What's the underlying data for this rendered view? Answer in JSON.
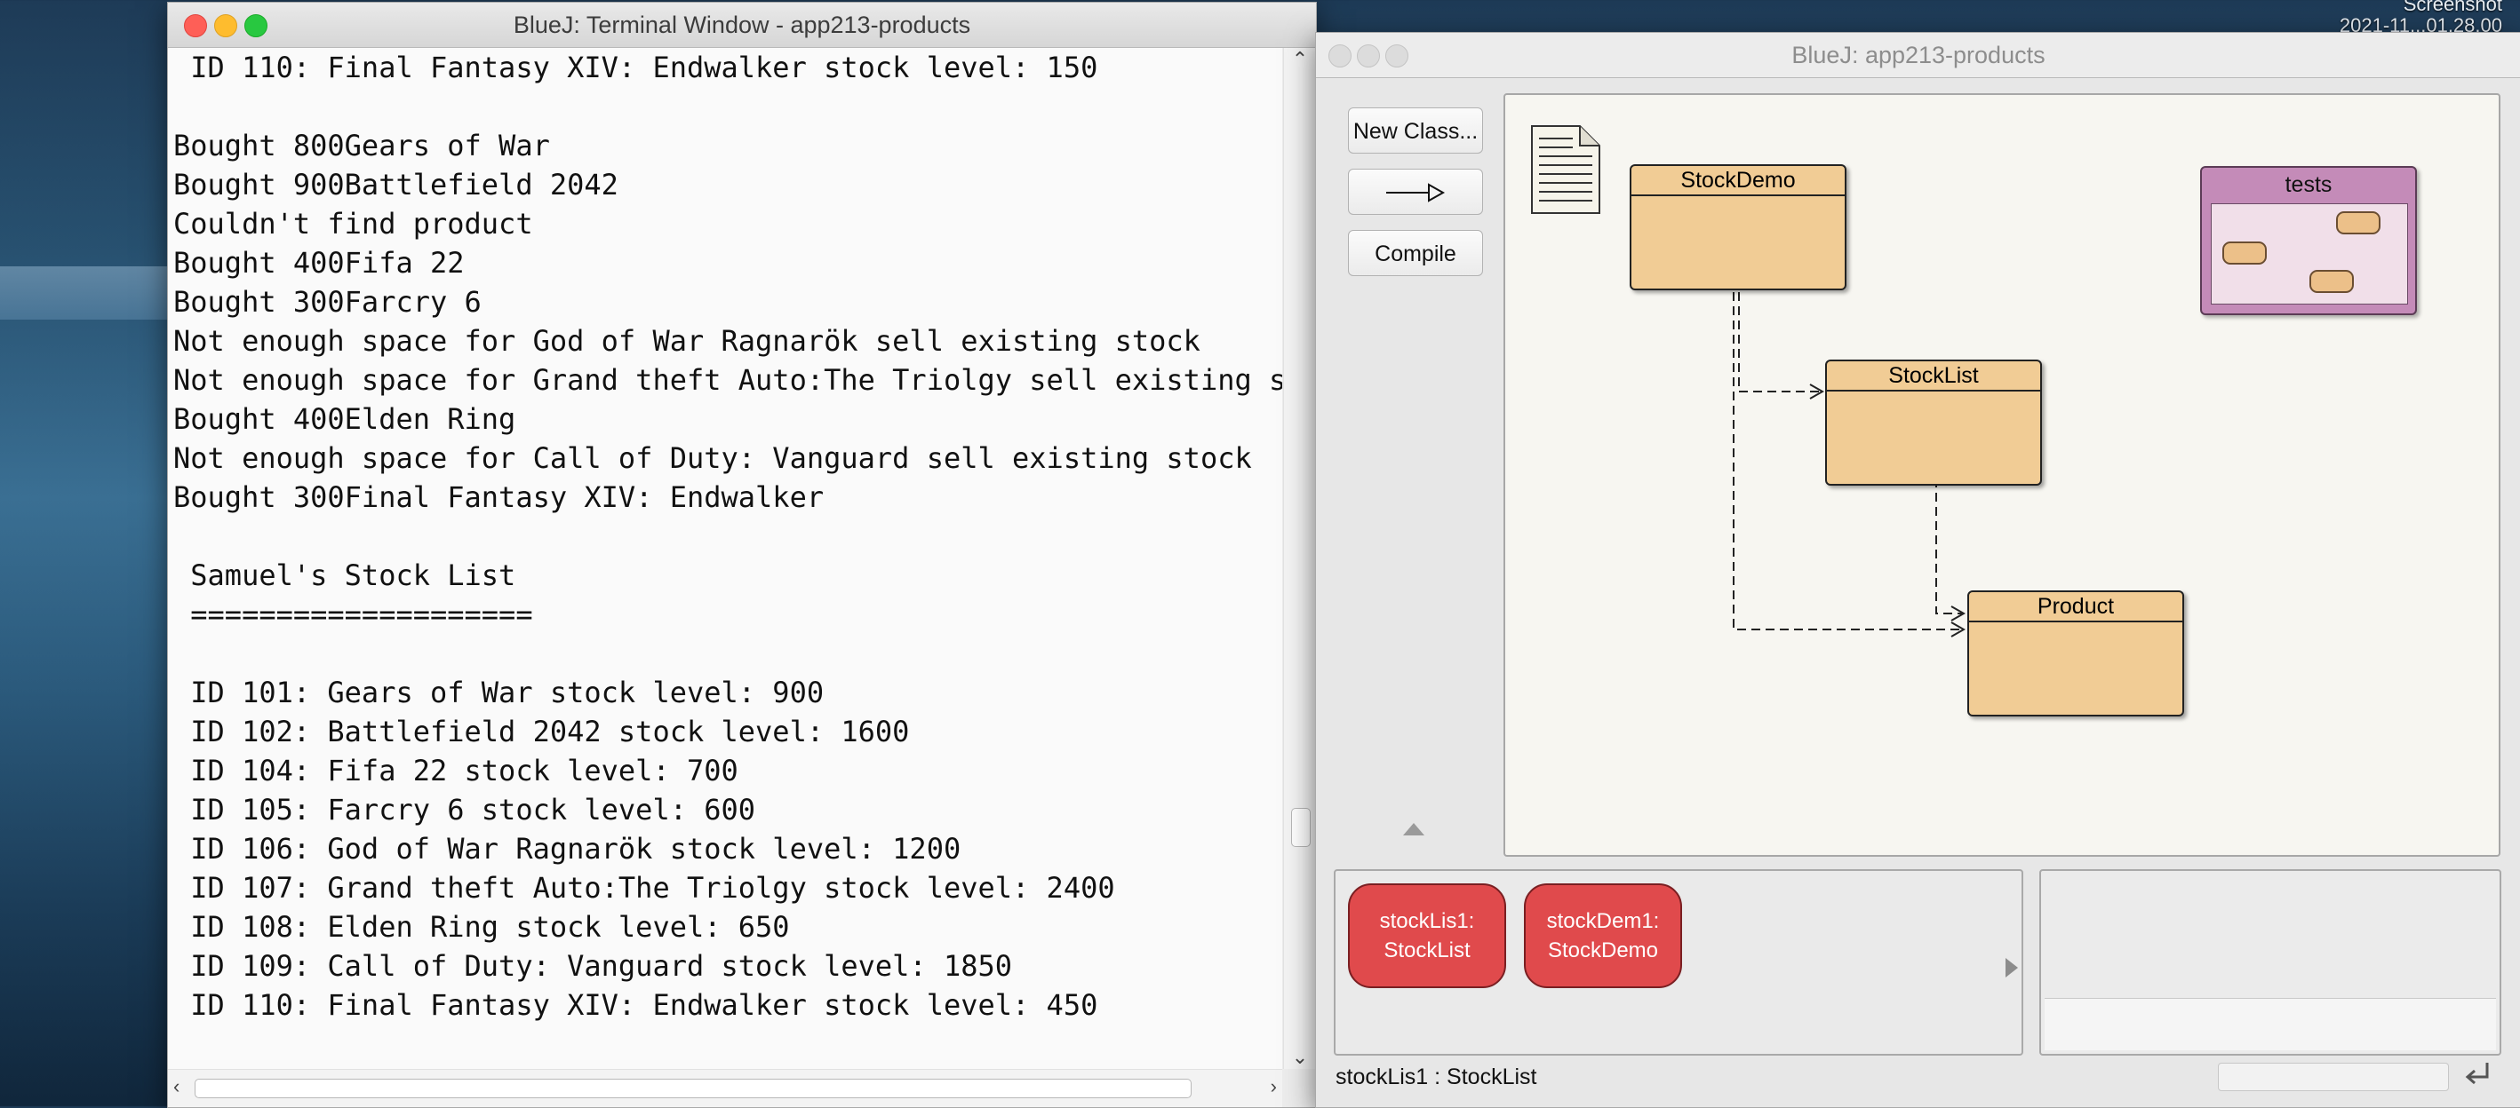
{
  "desktop": {
    "label_line1": "Screenshot",
    "label_line2": "2021-11...01.28.00"
  },
  "terminal": {
    "title": "BlueJ: Terminal Window - app213-products",
    "lines": [
      " ID 110: Final Fantasy XIV: Endwalker stock level: 150",
      "",
      "Bought 800Gears of War",
      "Bought 900Battlefield 2042",
      "Couldn't find product",
      "Bought 400Fifa 22",
      "Bought 300Farcry 6",
      "Not enough space for God of War Ragnarök sell existing stock",
      "Not enough space for Grand theft Auto:The Triolgy sell existing stock",
      "Bought 400Elden Ring",
      "Not enough space for Call of Duty: Vanguard sell existing stock",
      "Bought 300Final Fantasy XIV: Endwalker",
      "",
      " Samuel's Stock List",
      " ====================",
      "",
      " ID 101: Gears of War stock level: 900",
      " ID 102: Battlefield 2042 stock level: 1600",
      " ID 104: Fifa 22 stock level: 700",
      " ID 105: Farcry 6 stock level: 600",
      " ID 106: God of War Ragnarök stock level: 1200",
      " ID 107: Grand theft Auto:The Triolgy stock level: 2400",
      " ID 108: Elden Ring stock level: 650",
      " ID 109: Call of Duty: Vanguard stock level: 1850",
      " ID 110: Final Fantasy XIV: Endwalker stock level: 450"
    ]
  },
  "bluej": {
    "title": "BlueJ:  app213-products",
    "buttons": {
      "new_class": "New Class...",
      "compile": "Compile"
    },
    "classes": {
      "stockdemo": "StockDemo",
      "stocklist": "StockList",
      "product": "Product"
    },
    "package": {
      "name": "tests"
    },
    "objects": [
      {
        "name": "stockLis1:",
        "type": "StockList"
      },
      {
        "name": "stockDem1:",
        "type": "StockDemo"
      }
    ],
    "status": "stockLis1 : StockList"
  },
  "colors": {
    "class_fill": "#f1cc95",
    "package_fill": "#c48bb8",
    "object_fill": "#e04a4c"
  }
}
